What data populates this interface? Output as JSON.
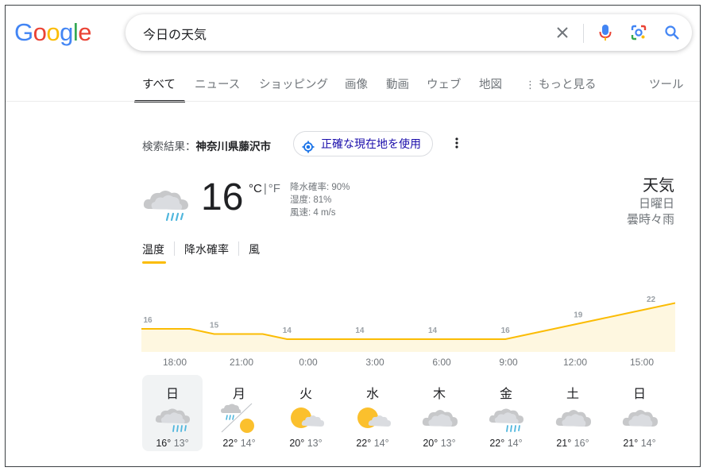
{
  "logo": {
    "letters": [
      "G",
      "o",
      "o",
      "g",
      "l",
      "e"
    ],
    "colors": [
      "#4285f4",
      "#ea4335",
      "#fbbc05",
      "#4285f4",
      "#34a853",
      "#ea4335"
    ]
  },
  "search": {
    "query": "今日の天気"
  },
  "tabs": [
    "すべて",
    "ニュース",
    "ショッピング",
    "画像",
    "動画",
    "ウェブ",
    "地図",
    "もっと見る",
    "ツール"
  ],
  "result": {
    "label": "検索結果：",
    "location": "神奈川県藤沢市",
    "use_location": "正確な現在地を使用"
  },
  "current": {
    "temp": "16",
    "unit_c": "°C",
    "unit_sep": "|",
    "unit_f": "°F",
    "precip": "降水確率: 90%",
    "humidity": "湿度: 81%",
    "wind": "風速: 4 m/s",
    "icon": "cloud-rain-icon"
  },
  "header": {
    "title": "天気",
    "day": "日曜日",
    "condition": "曇時々雨"
  },
  "subtabs": [
    "温度",
    "降水確率",
    "風"
  ],
  "colors": {
    "accent": "#fbbc04",
    "fill": "#fef7e0",
    "link": "#1a0dab"
  },
  "chart_data": {
    "type": "area",
    "x": [
      "18:00",
      "19:00",
      "20:00",
      "21:00",
      "22:00",
      "23:00",
      "0:00",
      "1:00",
      "2:00",
      "3:00",
      "4:00",
      "5:00",
      "6:00",
      "7:00",
      "8:00",
      "9:00",
      "10:00",
      "11:00",
      "12:00",
      "13:00",
      "14:00",
      "15:00",
      "16:00"
    ],
    "values": [
      16,
      16,
      16,
      15,
      15,
      15,
      14,
      14,
      14,
      14,
      14,
      14,
      14,
      14,
      14,
      14,
      15,
      16,
      17,
      18,
      19,
      20,
      21
    ],
    "point_labels": [
      {
        "x": "18:00",
        "label": "16"
      },
      {
        "x": "21:00",
        "label": "15"
      },
      {
        "x": "0:00",
        "label": "14"
      },
      {
        "x": "3:00",
        "label": "14"
      },
      {
        "x": "6:00",
        "label": "14"
      },
      {
        "x": "9:00",
        "label": "16"
      },
      {
        "x": "12:00",
        "label": "19"
      },
      {
        "x": "15:00",
        "label": "22"
      }
    ],
    "tick_labels": [
      "18:00",
      "21:00",
      "0:00",
      "3:00",
      "6:00",
      "9:00",
      "12:00",
      "15:00"
    ]
  },
  "forecast": [
    {
      "day": "日",
      "hi": "16°",
      "lo": "13°",
      "icon": "cloud-rain-icon"
    },
    {
      "day": "月",
      "hi": "22°",
      "lo": "14°",
      "icon": "rain-sun-split-icon"
    },
    {
      "day": "火",
      "hi": "20°",
      "lo": "13°",
      "icon": "partly-cloudy-icon"
    },
    {
      "day": "水",
      "hi": "22°",
      "lo": "14°",
      "icon": "partly-cloudy-icon"
    },
    {
      "day": "木",
      "hi": "20°",
      "lo": "13°",
      "icon": "cloudy-icon"
    },
    {
      "day": "金",
      "hi": "22°",
      "lo": "14°",
      "icon": "cloud-rain-icon"
    },
    {
      "day": "土",
      "hi": "21°",
      "lo": "16°",
      "icon": "cloudy-icon"
    },
    {
      "day": "日",
      "hi": "21°",
      "lo": "14°",
      "icon": "cloudy-icon"
    }
  ]
}
